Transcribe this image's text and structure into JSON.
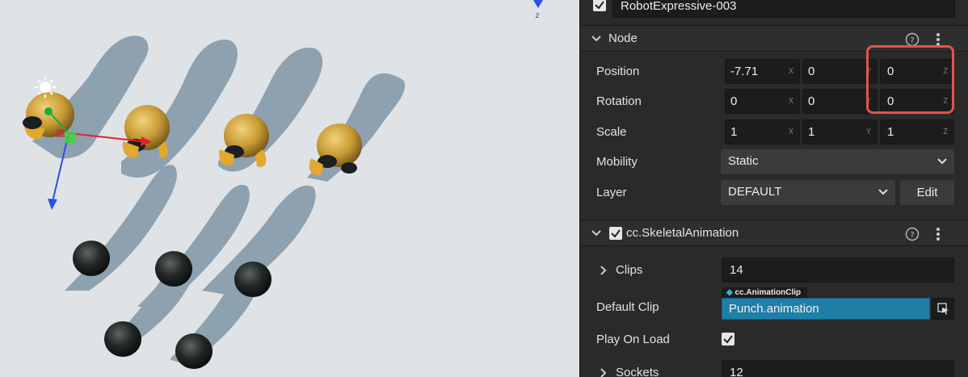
{
  "node_header": {
    "name": "RobotExpressive-003",
    "enabled": true
  },
  "node_section": {
    "title": "Node",
    "position": {
      "label": "Position",
      "x": "-7.71",
      "y": "0",
      "z": "0"
    },
    "rotation": {
      "label": "Rotation",
      "x": "0",
      "y": "0",
      "z": "0"
    },
    "scale": {
      "label": "Scale",
      "x": "1",
      "y": "1",
      "z": "1"
    },
    "mobility": {
      "label": "Mobility",
      "value": "Static"
    },
    "layer": {
      "label": "Layer",
      "value": "DEFAULT",
      "edit_label": "Edit"
    }
  },
  "axis_letters": {
    "x": "X",
    "y": "Y",
    "z": "Z"
  },
  "skeletal_section": {
    "title": "cc.SkeletalAnimation",
    "enabled": true,
    "clips": {
      "label": "Clips",
      "value": "14"
    },
    "default_clip": {
      "label": "Default Clip",
      "type_tag": "cc.AnimationClip",
      "value": "Punch.animation"
    },
    "play_on_load": {
      "label": "Play On Load",
      "checked": true
    },
    "sockets": {
      "label": "Sockets",
      "value": "12"
    }
  },
  "colors": {
    "panel_bg": "#2a2a2a",
    "field_bg": "#1c1c1c",
    "asset_blue": "#1f7fa6",
    "highlight_red": "#e3524f",
    "scene_ground": "#dfe3e6",
    "shadow": "#7f96a7",
    "robot_gold": "#d7ad4a"
  },
  "scene": {
    "gizmo_axes": [
      "x-axis-red",
      "y-axis-green",
      "z-axis-blue"
    ],
    "light_icon": "sun-icon"
  }
}
